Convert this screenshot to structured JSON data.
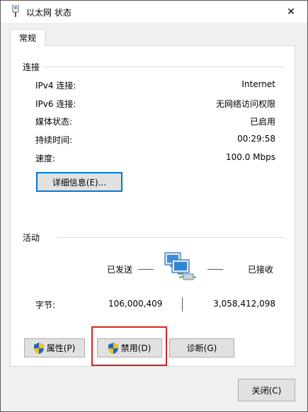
{
  "window": {
    "title": "以太网 状态",
    "close_glyph": "✕"
  },
  "tabs": [
    {
      "label": "常规"
    }
  ],
  "connection": {
    "section_title": "连接",
    "rows": [
      {
        "label": "IPv4 连接:",
        "value": "Internet"
      },
      {
        "label": "IPv6 连接:",
        "value": "无网络访问权限"
      },
      {
        "label": "媒体状态:",
        "value": "已启用"
      },
      {
        "label": "持续时间:",
        "value": "00:29:58"
      },
      {
        "label": "速度:",
        "value": "100.0 Mbps"
      }
    ],
    "details_button": "详细信息(E)..."
  },
  "activity": {
    "section_title": "活动",
    "sent_label": "已发送",
    "received_label": "已接收",
    "bytes_label": "字节:",
    "bytes_sent": "106,000,409",
    "bytes_received": "3,058,412,098"
  },
  "actions": {
    "properties": "属性(P)",
    "disable": "禁用(D)",
    "diagnose": "诊断(G)"
  },
  "footer": {
    "close": "关闭(C)"
  },
  "colors": {
    "accent": "#0078d7",
    "highlight": "#e01e1e",
    "panel_bg": "#ffffff",
    "dialog_bg": "#f0f0f0"
  }
}
